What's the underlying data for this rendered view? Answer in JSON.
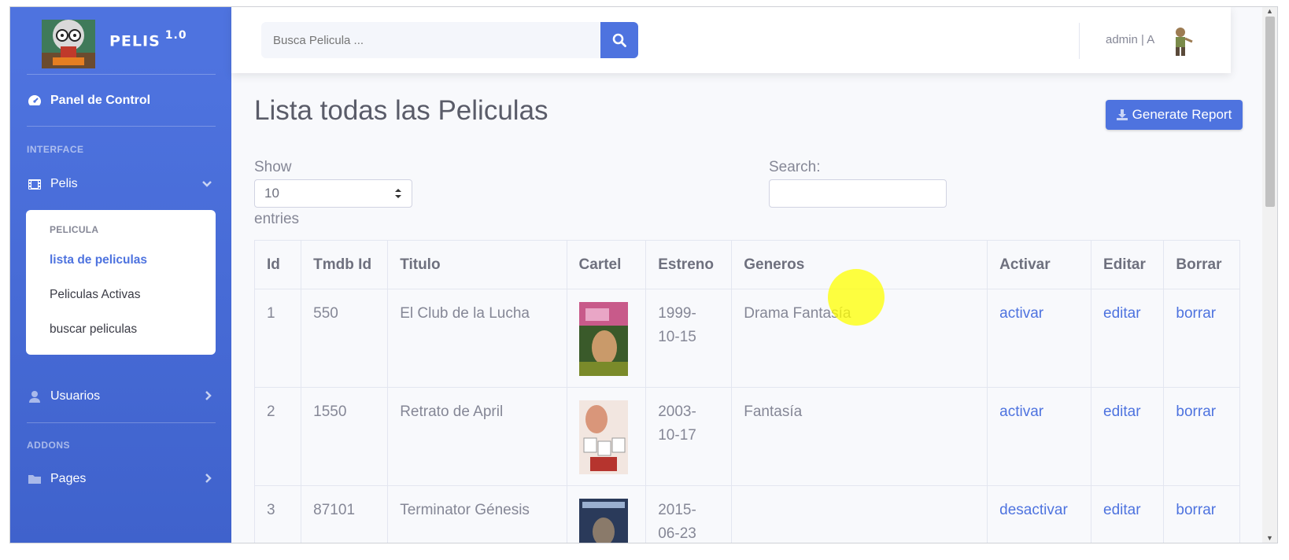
{
  "brand": {
    "name": "PELIS",
    "version": "1.0"
  },
  "sidebar": {
    "dashboard": "Panel de Control",
    "section_interface": "INTERFACE",
    "pelis": "Pelis",
    "submenu": {
      "header": "PELICULA",
      "items": [
        "lista de peliculas",
        "Peliculas Activas",
        "buscar peliculas"
      ]
    },
    "usuarios": "Usuarios",
    "section_addons": "ADDONS",
    "pages": "Pages"
  },
  "topbar": {
    "search_placeholder": "Busca Pelicula ...",
    "user": "admin | A"
  },
  "main": {
    "title": "Lista todas las Peliculas",
    "report_button": "Generate Report",
    "show_label": "Show",
    "entries_value": "10",
    "entries_label": "entries",
    "search_label": "Search:"
  },
  "table": {
    "headers": [
      "Id",
      "Tmdb Id",
      "Titulo",
      "Cartel",
      "Estreno",
      "Generos",
      "Activar",
      "Editar",
      "Borrar"
    ],
    "rows": [
      {
        "id": "1",
        "tmdb": "550",
        "titulo": "El Club de la Lucha",
        "estreno_a": "1999-",
        "estreno_b": "10-15",
        "generos": "Drama Fantasía",
        "activar": "activar",
        "editar": "editar",
        "borrar": "borrar"
      },
      {
        "id": "2",
        "tmdb": "1550",
        "titulo": "Retrato de April",
        "estreno_a": "2003-",
        "estreno_b": "10-17",
        "generos": "Fantasía",
        "activar": "activar",
        "editar": "editar",
        "borrar": "borrar"
      },
      {
        "id": "3",
        "tmdb": "87101",
        "titulo": "Terminator Génesis",
        "estreno_a": "2015-",
        "estreno_b": "06-23",
        "generos": "",
        "activar": "desactivar",
        "editar": "editar",
        "borrar": "borrar"
      }
    ]
  },
  "colors": {
    "primary": "#4e73df",
    "text_muted": "#858796",
    "highlight": "#ffff00"
  }
}
